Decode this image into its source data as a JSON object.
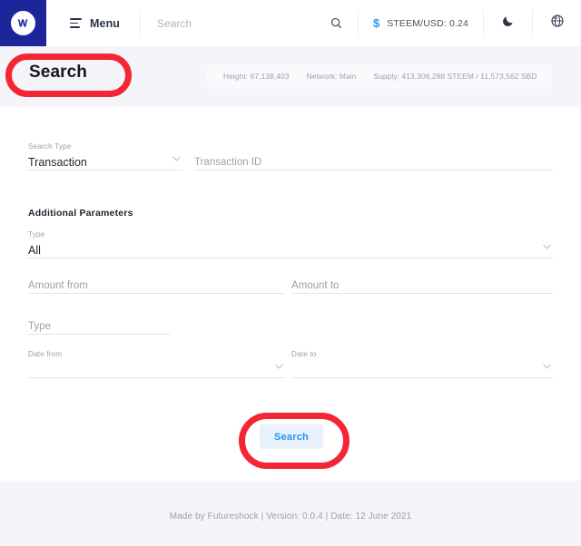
{
  "nav": {
    "logo_name": "steem-logo",
    "menu_label": "Menu",
    "search_placeholder": "Search",
    "search_value": "",
    "search_icon": "search-icon",
    "currency_icon": "dollar-icon",
    "price_label": "STEEM/USD: 0.24",
    "theme_icon": "moon-icon",
    "language_icon": "globe-icon"
  },
  "header": {
    "title": "Search",
    "info": [
      "Height: 67,138,403",
      "Network: Main",
      "Supply: 413,306,288 STEEM / 11,573,562 SBD"
    ]
  },
  "form": {
    "search_type": {
      "label": "Search Type",
      "value": "Transaction",
      "icon": "chevron-down-icon"
    },
    "transaction_id": {
      "placeholder": "Transaction ID",
      "value": ""
    },
    "additional_heading": "Additional Parameters",
    "type_select": {
      "label": "Type",
      "value": "All",
      "icon": "chevron-down-icon"
    },
    "amount_from": {
      "placeholder": "Amount from",
      "value": ""
    },
    "amount_to": {
      "placeholder": "Amount to",
      "value": ""
    },
    "type_text": {
      "placeholder": "Type",
      "value": ""
    },
    "date_from": {
      "label": "Date from",
      "value": "",
      "icon": "chevron-down-icon"
    },
    "date_to": {
      "label": "Date to",
      "value": "",
      "icon": "chevron-down-icon"
    },
    "submit_label": "Search"
  },
  "footer": {
    "text": "Made by Futureshock | Version: 0.0.4 | Date: 12 June 2021"
  },
  "colors": {
    "logo_background": "#1c259a",
    "accent_blue": "#2196f3",
    "button_background": "#e9f1fb",
    "annotation_red": "#f42534",
    "band_background": "#f4f4f9"
  }
}
